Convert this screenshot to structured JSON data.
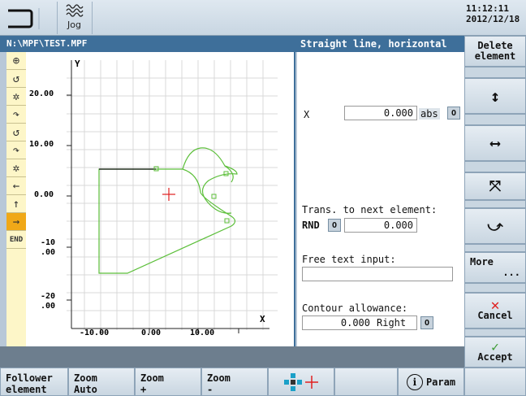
{
  "header": {
    "op_mode_icon": "jog-wave-icon",
    "op_mode_label": "Jog",
    "clock_time": "11:12:11",
    "clock_date": "2012/12/18"
  },
  "path": "N:\\MPF\\TEST.MPF",
  "title": "Straight line, horizontal",
  "toolbar": {
    "items": [
      {
        "icon": "start-point-icon",
        "glyph": "⊕"
      },
      {
        "icon": "arc-ccw-icon",
        "glyph": "↺"
      },
      {
        "icon": "pole-icon",
        "glyph": "✲"
      },
      {
        "icon": "arc-cw-icon",
        "glyph": "↷"
      },
      {
        "icon": "arc-ccw-icon-2",
        "glyph": "↺"
      },
      {
        "icon": "arc-cw-icon-2",
        "glyph": "↷"
      },
      {
        "icon": "pole-icon-2",
        "glyph": "✲"
      },
      {
        "icon": "line-left-icon",
        "glyph": "←"
      },
      {
        "icon": "line-up-icon",
        "glyph": "↑"
      },
      {
        "icon": "line-right-icon",
        "glyph": "→"
      },
      {
        "icon": "end-icon",
        "glyph": "END"
      }
    ]
  },
  "graphic": {
    "axis_y": "Y",
    "axis_x": "X",
    "y_ticks": [
      "20.00",
      "10.00",
      "0.00",
      "-10",
      ".00",
      "-20",
      ".00"
    ],
    "x_ticks": [
      "-10.00",
      "0.00",
      "10.00"
    ]
  },
  "form": {
    "x_label": "X",
    "x_value": "0.000",
    "x_mode": "abs",
    "trans_label": "Trans. to next element:",
    "trans_type": "RND",
    "trans_value": "0.000",
    "free_text_label": "Free text input:",
    "free_text_value": "",
    "allowance_label": "Contour allowance:",
    "allowance_value": "0.000",
    "allowance_side": "Right",
    "toggle_glyph": "O"
  },
  "vsoftkeys": {
    "delete_line1": "Delete",
    "delete_line2": "element",
    "more": "More",
    "more_dots": "...",
    "cancel": "Cancel",
    "accept": "Accept"
  },
  "hsoftkeys": {
    "follower_line1": "Follower",
    "follower_line2": "element",
    "zoom_auto_line1": "Zoom",
    "zoom_auto_line2": "Auto",
    "zoom_plus_line1": "Zoom",
    "zoom_plus_line2": "+",
    "zoom_minus_line1": "Zoom",
    "zoom_minus_line2": "-",
    "param": "Param"
  },
  "colors": {
    "accent": "#3e6f9a",
    "contour": "#5cbf3a",
    "cursor": "#e02020",
    "active_tool": "#f0a818",
    "cancel": "#e02020",
    "accept": "#3a9a30"
  }
}
